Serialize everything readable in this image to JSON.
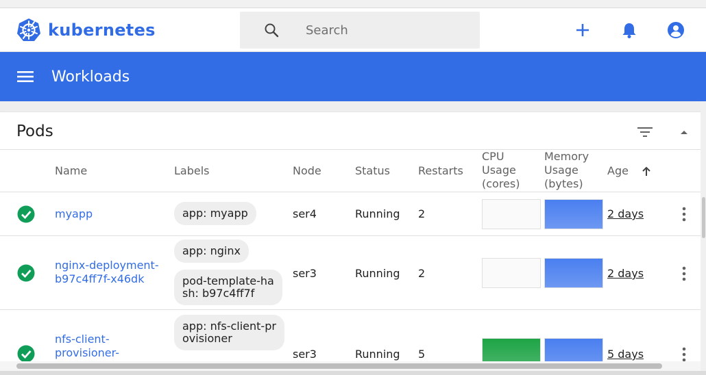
{
  "header": {
    "brand": "kubernetes",
    "search_placeholder": "Search"
  },
  "toolbar": {
    "title": "Workloads"
  },
  "pods": {
    "title": "Pods",
    "columns": {
      "name": "Name",
      "labels": "Labels",
      "node": "Node",
      "status": "Status",
      "restarts": "Restarts",
      "cpu": [
        "CPU",
        "Usage",
        "(cores)"
      ],
      "memory": [
        "Memory",
        "Usage",
        "(bytes)"
      ],
      "age": "Age"
    },
    "rows": [
      {
        "name": [
          "myapp"
        ],
        "labels": [
          "app: myapp"
        ],
        "node": "ser4",
        "status": "Running",
        "restarts": "2",
        "cpu_level": 0,
        "memory_level": 1,
        "age": "2 days"
      },
      {
        "name": [
          "nginx-deployment-",
          "b97c4ff7f-x46dk"
        ],
        "labels": [
          "app: nginx",
          [
            "pod-template-ha",
            "sh: b97c4ff7f"
          ]
        ],
        "node": "ser3",
        "status": "Running",
        "restarts": "2",
        "cpu_level": 0,
        "memory_level": 1,
        "age": "2 days"
      },
      {
        "name": [
          "nfs-client-",
          "provisioner-"
        ],
        "labels": [
          [
            "app: nfs-client-pr",
            "ovisioner"
          ]
        ],
        "node": "ser3",
        "status": "Running",
        "restarts": "5",
        "cpu_level": 1,
        "memory_level": 1,
        "age": "5 days"
      }
    ]
  },
  "colors": {
    "brand": "#326de6",
    "running": "#0f9d58",
    "cpu_fill": "#1ea446",
    "memory_fill": "#4a7ff0"
  },
  "icons": {
    "logo": "kubernetes-helm-icon",
    "search": "search-icon",
    "add": "add-icon",
    "bell": "bell-icon",
    "account": "account-icon",
    "menu": "menu-icon",
    "filter": "filter-icon",
    "collapse": "chevron-up-icon",
    "sort": "arrow-up-icon",
    "status": "check-circle-icon",
    "more": "kebab-icon"
  }
}
